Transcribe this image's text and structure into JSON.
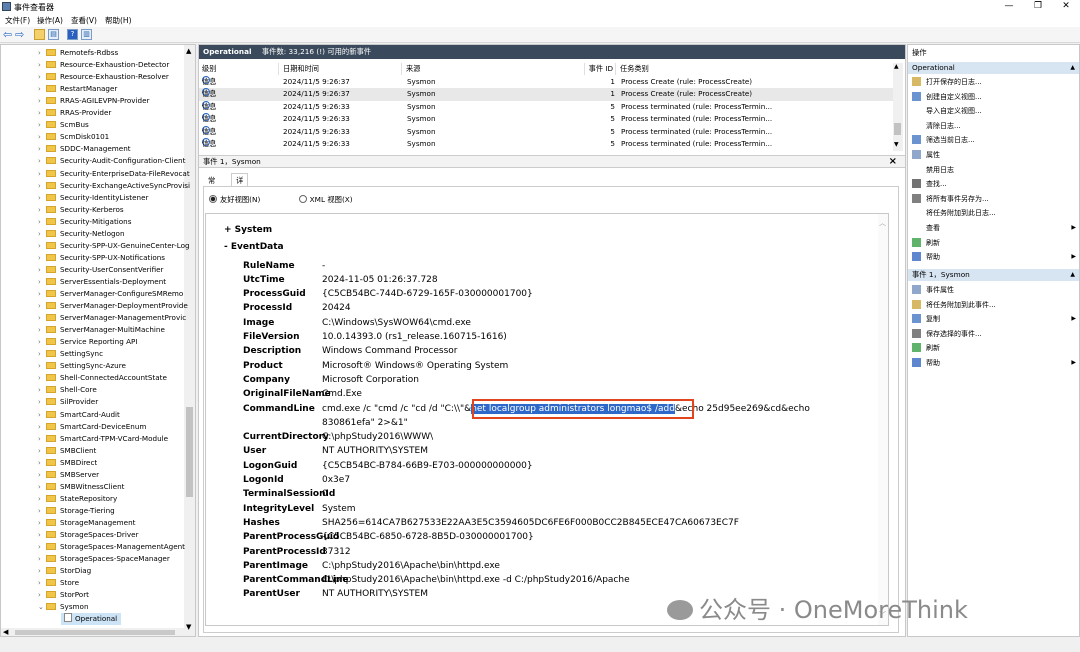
{
  "window": {
    "title": "事件查看器"
  },
  "menu": [
    "文件(F)",
    "操作(A)",
    "查看(V)",
    "帮助(H)"
  ],
  "tree": {
    "items": [
      "Remotefs-Rdbss",
      "Resource-Exhaustion-Detector",
      "Resource-Exhaustion-Resolver",
      "RestartManager",
      "RRAS-AGILEVPN-Provider",
      "RRAS-Provider",
      "ScmBus",
      "ScmDisk0101",
      "SDDC-Management",
      "Security-Audit-Configuration-Client",
      "Security-EnterpriseData-FileRevocat",
      "Security-ExchangeActiveSyncProvisi",
      "Security-IdentityListener",
      "Security-Kerberos",
      "Security-Mitigations",
      "Security-Netlogon",
      "Security-SPP-UX-GenuineCenter-Log",
      "Security-SPP-UX-Notifications",
      "Security-UserConsentVerifier",
      "ServerEssentials-Deployment",
      "ServerManager-ConfigureSMRemo",
      "ServerManager-DeploymentProvide",
      "ServerManager-ManagementProvic",
      "ServerManager-MultiMachine",
      "Service Reporting API",
      "SettingSync",
      "SettingSync-Azure",
      "Shell-ConnectedAccountState",
      "Shell-Core",
      "SilProvider",
      "SmartCard-Audit",
      "SmartCard-DeviceEnum",
      "SmartCard-TPM-VCard-Module",
      "SMBClient",
      "SMBDirect",
      "SMBServer",
      "SMBWitnessClient",
      "StateRepository",
      "Storage-Tiering",
      "StorageManagement",
      "StorageSpaces-Driver",
      "StorageSpaces-ManagementAgent",
      "StorageSpaces-SpaceManager",
      "StorDiag",
      "Store",
      "StorPort",
      "Sysmon"
    ],
    "selected": "Operational"
  },
  "log": {
    "name": "Operational",
    "summary": "事件数: 33,216 (!) 可用的新事件",
    "columns": [
      "级别",
      "日期和时间",
      "来源",
      "事件 ID",
      "任务类别"
    ],
    "rows": [
      {
        "level": "信息",
        "time": "2024/11/5 9:26:37",
        "source": "Sysmon",
        "id": "1",
        "task": "Process Create (rule: ProcessCreate)"
      },
      {
        "level": "信息",
        "time": "2024/11/5 9:26:37",
        "source": "Sysmon",
        "id": "1",
        "task": "Process Create (rule: ProcessCreate)"
      },
      {
        "level": "信息",
        "time": "2024/11/5 9:26:33",
        "source": "Sysmon",
        "id": "5",
        "task": "Process terminated (rule: ProcessTermin..."
      },
      {
        "level": "信息",
        "time": "2024/11/5 9:26:33",
        "source": "Sysmon",
        "id": "5",
        "task": "Process terminated (rule: ProcessTermin..."
      },
      {
        "level": "信息",
        "time": "2024/11/5 9:26:33",
        "source": "Sysmon",
        "id": "5",
        "task": "Process terminated (rule: ProcessTermin..."
      },
      {
        "level": "信息",
        "time": "2024/11/5 9:26:33",
        "source": "Sysmon",
        "id": "5",
        "task": "Process terminated (rule: ProcessTermin..."
      }
    ]
  },
  "event": {
    "header": "事件 1，Sysmon",
    "close": "×",
    "tabs": [
      "常规",
      "详细信息"
    ],
    "radio_friendly": "友好视图(N)",
    "radio_xml": "XML 视图(X)",
    "sec_system": "+  System",
    "sec_eventdata": "-  EventData",
    "fields": [
      {
        "k": "RuleName",
        "v": "-"
      },
      {
        "k": "UtcTime",
        "v": "2024-11-05 01:26:37.728"
      },
      {
        "k": "ProcessGuid",
        "v": "{C5CB54BC-744D-6729-165F-030000001700}"
      },
      {
        "k": "ProcessId",
        "v": "20424"
      },
      {
        "k": "Image",
        "v": "C:\\Windows\\SysWOW64\\cmd.exe"
      },
      {
        "k": "FileVersion",
        "v": "10.0.14393.0 (rs1_release.160715-1616)"
      },
      {
        "k": "Description",
        "v": "Windows Command Processor"
      },
      {
        "k": "Product",
        "v": "Microsoft® Windows® Operating System"
      },
      {
        "k": "Company",
        "v": "Microsoft Corporation"
      },
      {
        "k": "OriginalFileName",
        "v": "Cmd.Exe"
      }
    ],
    "cmdline_key": "CommandLine",
    "cmdline_pre": "cmd.exe /c \"cmd /c \"cd /d \"C:\\\\\"&",
    "cmdline_hl": "net localgroup administrators longmao$ /add",
    "cmdline_post": "&echo 25d95ee269&cd&echo",
    "cmdline_line2": "830861efa\" 2>&1\"",
    "fields2": [
      {
        "k": "CurrentDirectory",
        "v": "C:\\phpStudy2016\\WWW\\"
      },
      {
        "k": "User",
        "v": "NT AUTHORITY\\SYSTEM"
      },
      {
        "k": "LogonGuid",
        "v": "{C5CB54BC-B784-66B9-E703-000000000000}"
      },
      {
        "k": "LogonId",
        "v": "0x3e7"
      },
      {
        "k": "TerminalSessionId",
        "v": "0"
      },
      {
        "k": "IntegrityLevel",
        "v": "System"
      },
      {
        "k": "Hashes",
        "v": "SHA256=614CA7B627533E22AA3E5C3594605DC6FE6F000B0CC2B845ECE47CA60673EC7F"
      },
      {
        "k": "ParentProcessGuid",
        "v": "{C5CB54BC-6850-6728-8B5D-030000001700}"
      },
      {
        "k": "ParentProcessId",
        "v": "37312"
      },
      {
        "k": "ParentImage",
        "v": "C:\\phpStudy2016\\Apache\\bin\\httpd.exe"
      },
      {
        "k": "ParentCommandLine",
        "v": "C:\\phpStudy2016\\Apache\\bin\\httpd.exe -d C:/phpStudy2016/Apache"
      },
      {
        "k": "ParentUser",
        "v": "NT AUTHORITY\\SYSTEM"
      }
    ]
  },
  "actions": {
    "header": "操作",
    "group1": "Operational",
    "items1": [
      "打开保存的日志...",
      "创建自定义视图...",
      "导入自定义视图...",
      "清除日志...",
      "筛选当前日志...",
      "属性",
      "禁用日志",
      "查找...",
      "将所有事件另存为...",
      "将任务附加到此日志...",
      "查看",
      "刷新",
      "帮助"
    ],
    "group2": "事件 1，Sysmon",
    "items2": [
      "事件属性",
      "将任务附加到此事件...",
      "复制",
      "保存选择的事件...",
      "刷新",
      "帮助"
    ]
  },
  "watermark": "公众号 · OneMoreThink"
}
